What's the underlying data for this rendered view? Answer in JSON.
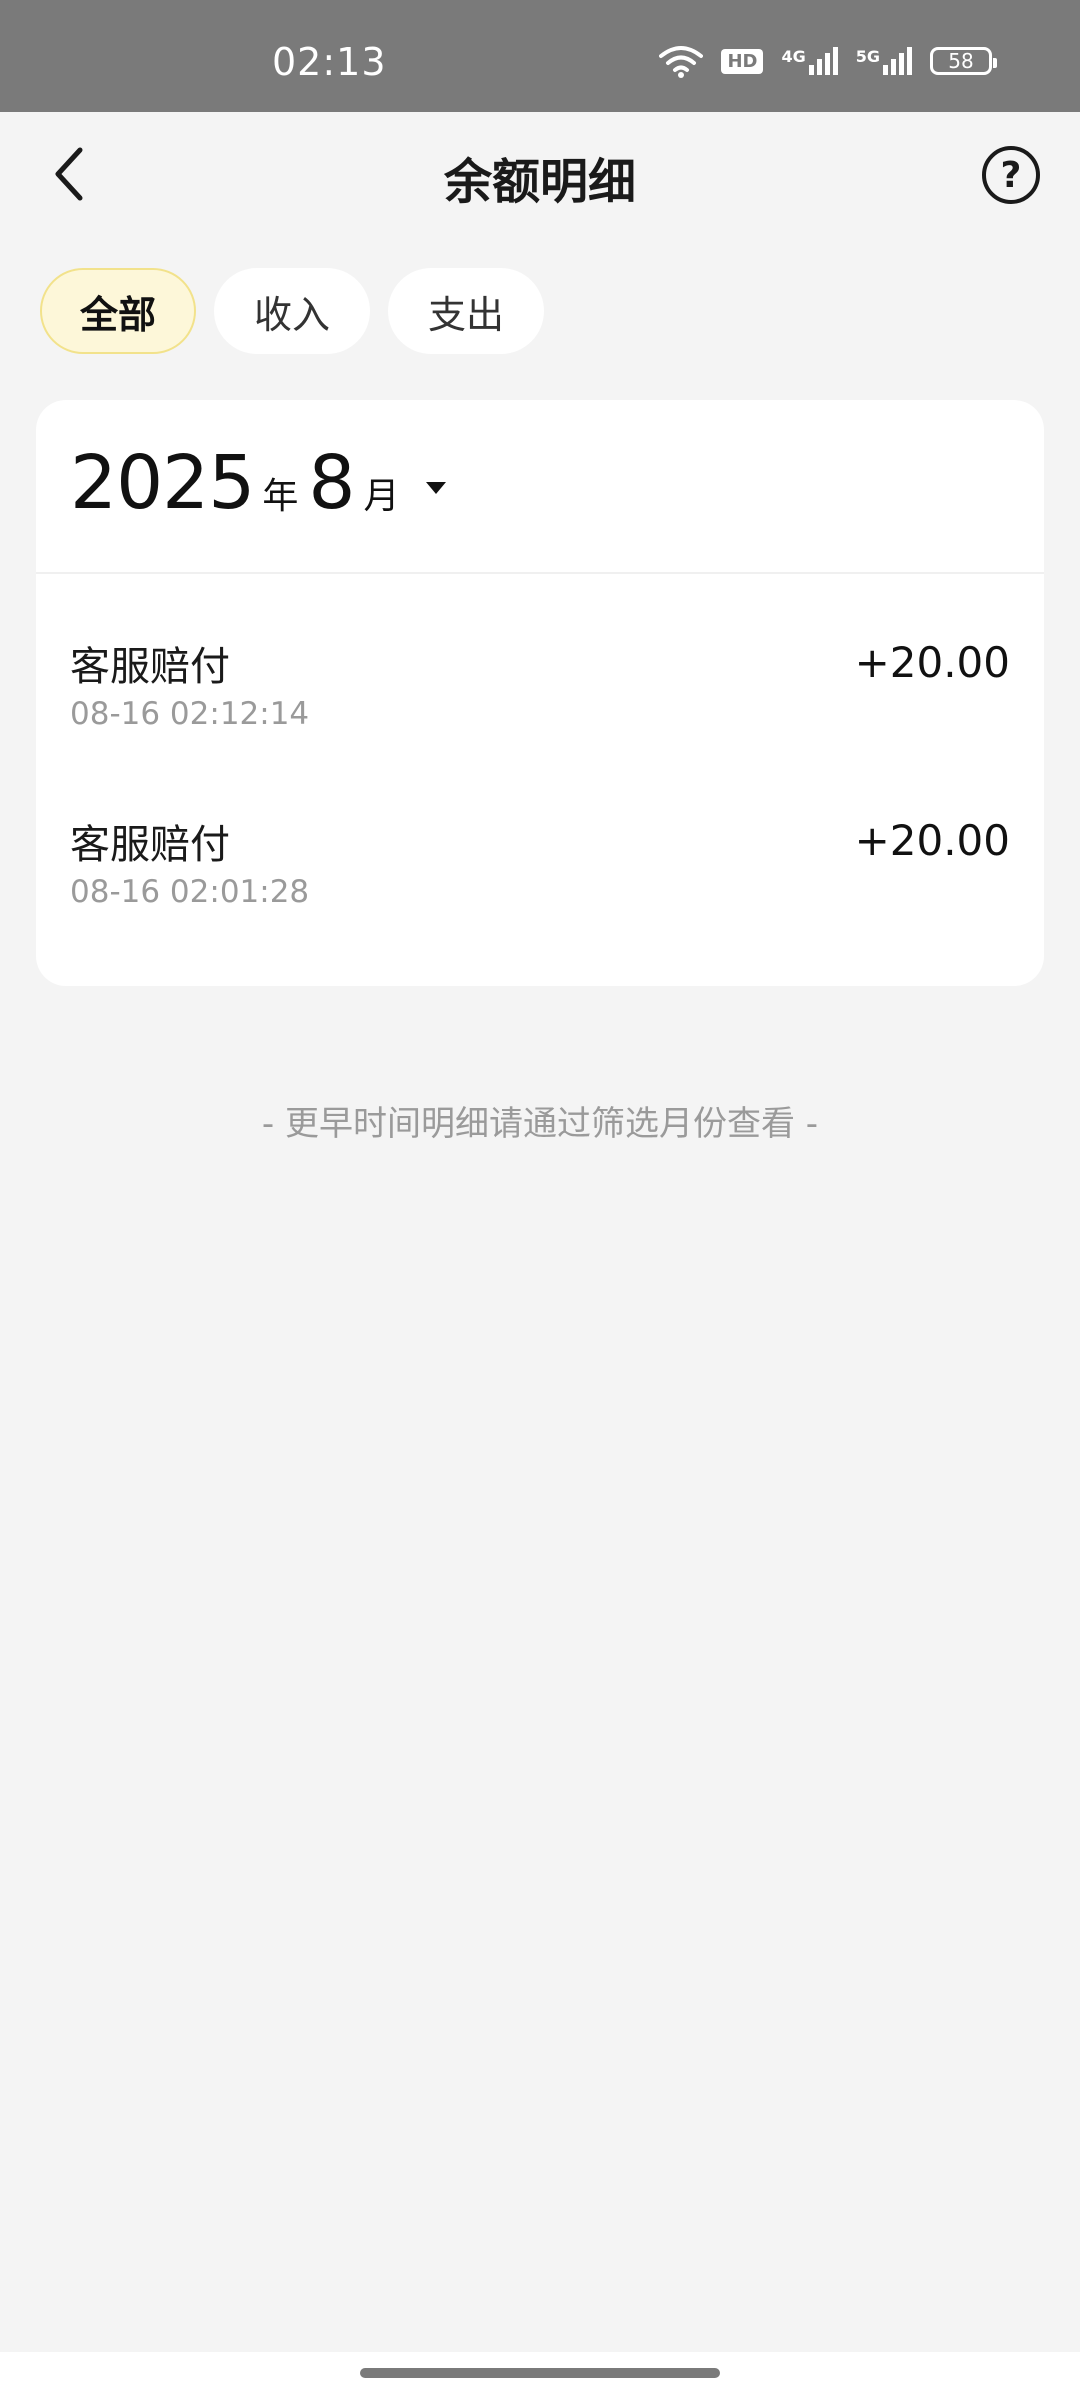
{
  "status_bar": {
    "time": "02:13",
    "battery": "58",
    "network_4g": "4G",
    "network_5g": "5G",
    "hd": "HD"
  },
  "header": {
    "title": "余额明细",
    "help_label": "?"
  },
  "tabs": [
    {
      "label": "全部",
      "active": true
    },
    {
      "label": "收入",
      "active": false
    },
    {
      "label": "支出",
      "active": false
    }
  ],
  "month_picker": {
    "year": "2025",
    "year_unit": "年",
    "month": "8",
    "month_unit": "月"
  },
  "records": [
    {
      "title": "客服赔付",
      "time": "08-16 02:12:14",
      "amount": "+20.00"
    },
    {
      "title": "客服赔付",
      "time": "08-16 02:01:28",
      "amount": "+20.00"
    }
  ],
  "footer_note": "- 更早时间明细请通过筛选月份查看 -",
  "colors": {
    "status_bar_bg": "#7a7a7a",
    "page_bg": "#f4f4f4",
    "active_tab_bg": "#fdf7d9",
    "active_tab_border": "#f2e28b"
  }
}
